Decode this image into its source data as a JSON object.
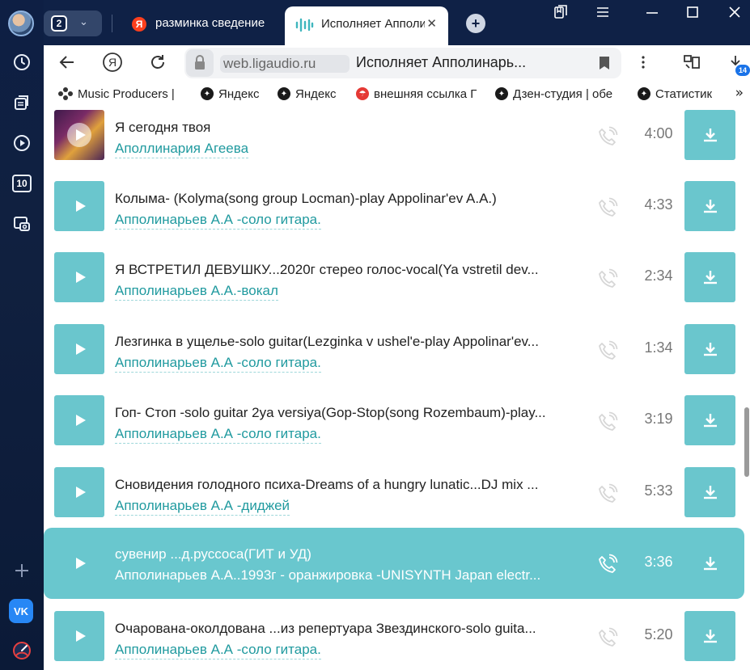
{
  "tabs": {
    "count": "2",
    "items": [
      {
        "title": "разминка сведение"
      },
      {
        "title": "Исполняет Апполинарь"
      }
    ]
  },
  "address": {
    "host": "web.ligaudio.ru",
    "page_title": "Исполняет Апполинарь..."
  },
  "downloads_badge": "14",
  "sidepanel": {
    "counter_label": "10",
    "vk_label": "VK"
  },
  "bookmarks": [
    {
      "label": "Music Producers |"
    },
    {
      "label": "Яндекс"
    },
    {
      "label": "Яндекс"
    },
    {
      "label": "внешняя ссылка Г"
    },
    {
      "label": "Дзен-студия | обе"
    },
    {
      "label": "Статистик"
    }
  ],
  "tracks": [
    {
      "title": "Я сегодня твоя",
      "artist": "Аполлинария Агеева",
      "duration": "4:00",
      "cover": true,
      "active": false
    },
    {
      "title": "Колыма- (Kolyma(song group Locman)-play Appolinar'ev A.A.)",
      "artist": "Апполинарьев А.А -соло гитара.",
      "duration": "4:33",
      "cover": false,
      "active": false
    },
    {
      "title": "Я ВСТРЕТИЛ ДЕВУШКУ...2020г стерео голос-vocal(Ya vstretil dev...",
      "artist": "Апполинарьев А.А.-вокал",
      "duration": "2:34",
      "cover": false,
      "active": false
    },
    {
      "title": "Лезгинка в ущелье-solo guitar(Lezginka v ushel'e-play Appolinar'ev...",
      "artist": "Апполинарьев А.А -соло гитара.",
      "duration": "1:34",
      "cover": false,
      "active": false
    },
    {
      "title": "Гоп- Стоп -solo guitar 2ya versiya(Gop-Stop(song Rozembaum)-play...",
      "artist": "Апполинарьев А.А -соло гитара.",
      "duration": "3:19",
      "cover": false,
      "active": false
    },
    {
      "title": "Сновидения голодного психа-Dreams of a hungry lunatic...DJ mix ...",
      "artist": "Апполинарьев А.А -диджей",
      "duration": "5:33",
      "cover": false,
      "active": false
    },
    {
      "title": "сувенир ...д.руссоса(ГИТ и УД)",
      "artist": "Апполинарьев А.А..1993г - оранжировка -UNISYNTH Japan electr...",
      "duration": "3:36",
      "cover": false,
      "active": true
    },
    {
      "title": "Очарована-околдована ...из репертуара Звездинского-solo guita...",
      "artist": "Апполинарьев А.А -соло гитара.",
      "duration": "5:20",
      "cover": false,
      "active": false
    }
  ]
}
